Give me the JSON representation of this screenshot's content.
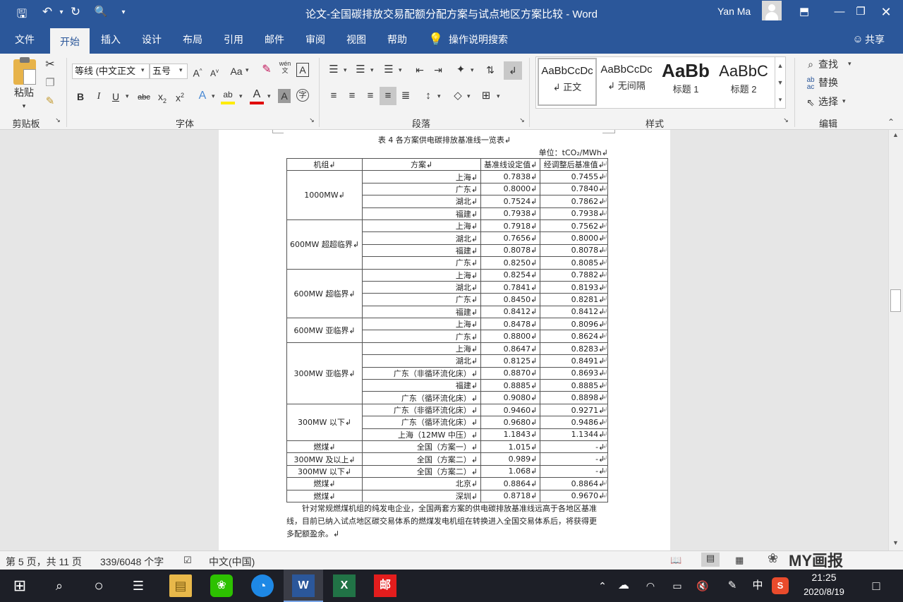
{
  "window": {
    "title": "论文-全国碳排放交易配额分配方案与试点地区方案比较  -  Word",
    "user": "Yan Ma"
  },
  "ribbon_tabs": [
    "文件",
    "开始",
    "插入",
    "设计",
    "布局",
    "引用",
    "邮件",
    "审阅",
    "视图",
    "帮助"
  ],
  "active_tab": "开始",
  "tell_me": "操作说明搜索",
  "share": "共享",
  "clipboard": {
    "paste": "粘贴",
    "label": "剪贴板"
  },
  "font": {
    "name": "等线 (中文正文",
    "size": "五号",
    "label": "字体",
    "case_label": "Aa",
    "wen_label": "wén",
    "char_border": "A"
  },
  "paragraph": {
    "label": "段落"
  },
  "styles": {
    "label": "样式",
    "items": [
      {
        "sample": "AaBbCcDc",
        "name": "↲ 正文"
      },
      {
        "sample": "AaBbCcDc",
        "name": "↲ 无间隔"
      },
      {
        "sample": "AaBb",
        "name": "标题 1"
      },
      {
        "sample": "AaBbC",
        "name": "标题 2"
      }
    ]
  },
  "editing": {
    "label": "编辑",
    "find": "查找",
    "replace": "替换",
    "select": "选择"
  },
  "document": {
    "caption": "表 4 各方案供电碳排放基准线一览表↲",
    "unit": "单位：tCO₂/MWh↲",
    "headers": [
      "机组↲",
      "方案↲",
      "基准线设定值↲",
      "经调整后基准值↲"
    ],
    "groups": [
      {
        "unit": "1000MW↲",
        "rows": [
          [
            "上海↲",
            "0.7838↲",
            "0.7455↲"
          ],
          [
            "广东↲",
            "0.8000↲",
            "0.7840↲"
          ],
          [
            "湖北↲",
            "0.7524↲",
            "0.7862↲"
          ],
          [
            "福建↲",
            "0.7938↲",
            "0.7938↲"
          ]
        ]
      },
      {
        "unit": "600MW 超超临界↲",
        "rows": [
          [
            "上海↲",
            "0.7918↲",
            "0.7562↲"
          ],
          [
            "湖北↲",
            "0.7656↲",
            "0.8000↲"
          ],
          [
            "福建↲",
            "0.8078↲",
            "0.8078↲"
          ],
          [
            "广东↲",
            "0.8250↲",
            "0.8085↲"
          ]
        ]
      },
      {
        "unit": "600MW 超临界↲",
        "rows": [
          [
            "上海↲",
            "0.8254↲",
            "0.7882↲"
          ],
          [
            "湖北↲",
            "0.7841↲",
            "0.8193↲"
          ],
          [
            "广东↲",
            "0.8450↲",
            "0.8281↲"
          ],
          [
            "福建↲",
            "0.8412↲",
            "0.8412↲"
          ]
        ]
      },
      {
        "unit": "600MW 亚临界↲",
        "rows": [
          [
            "上海↲",
            "0.8478↲",
            "0.8096↲"
          ],
          [
            "广东↲",
            "0.8800↲",
            "0.8624↲"
          ]
        ]
      },
      {
        "unit": "300MW 亚临界↲",
        "rows": [
          [
            "上海↲",
            "0.8647↲",
            "0.8283↲"
          ],
          [
            "湖北↲",
            "0.8125↲",
            "0.8491↲"
          ],
          [
            "广东（非循环流化床）↲",
            "0.8870↲",
            "0.8693↲"
          ],
          [
            "福建↲",
            "0.8885↲",
            "0.8885↲"
          ],
          [
            "广东（循环流化床）↲",
            "0.9080↲",
            "0.8898↲"
          ]
        ]
      },
      {
        "unit": "300MW 以下↲",
        "rows": [
          [
            "广东（非循环流化床）↲",
            "0.9460↲",
            "0.9271↲"
          ],
          [
            "广东（循环流化床）↲",
            "0.9680↲",
            "0.9486↲"
          ],
          [
            "上海（12MW 中压）↲",
            "1.1843↲",
            "1.1344↲"
          ]
        ]
      },
      {
        "unit": "燃煤↲",
        "rows": [
          [
            "全国（方案一）↲",
            "1.015↲",
            "-↲"
          ]
        ]
      },
      {
        "unit": "300MW 及以上↲",
        "rows": [
          [
            "全国（方案二）↲",
            "0.989↲",
            "-↲"
          ]
        ]
      },
      {
        "unit": "300MW 以下↲",
        "rows": [
          [
            "全国（方案二）↲",
            "1.068↲",
            "-↲"
          ]
        ]
      },
      {
        "unit": "燃煤↲",
        "rows": [
          [
            "北京↲",
            "0.8864↲",
            "0.8864↲"
          ]
        ]
      },
      {
        "unit": "燃煤↲",
        "rows": [
          [
            "深圳↲",
            "0.8718↲",
            "0.9670↲"
          ]
        ]
      }
    ],
    "row_end_mark": "↲",
    "paragraph_lines": [
      "针对常规燃煤机组的纯发电企业，全国两套方案的供电碳排放基准线远高于各地区基准",
      "线，目前已纳入试点地区碳交易体系的燃煤发电机组在转换进入全国交易体系后，将获得更",
      "多配额盈余。↲"
    ]
  },
  "status": {
    "page": "第 5 页，共 11 页",
    "words": "339/6048 个字",
    "language": "中文(中国)"
  },
  "watermark": "MY画报",
  "taskbar": {
    "time": "21:25",
    "date": "2020/8/19",
    "ime": "中"
  }
}
